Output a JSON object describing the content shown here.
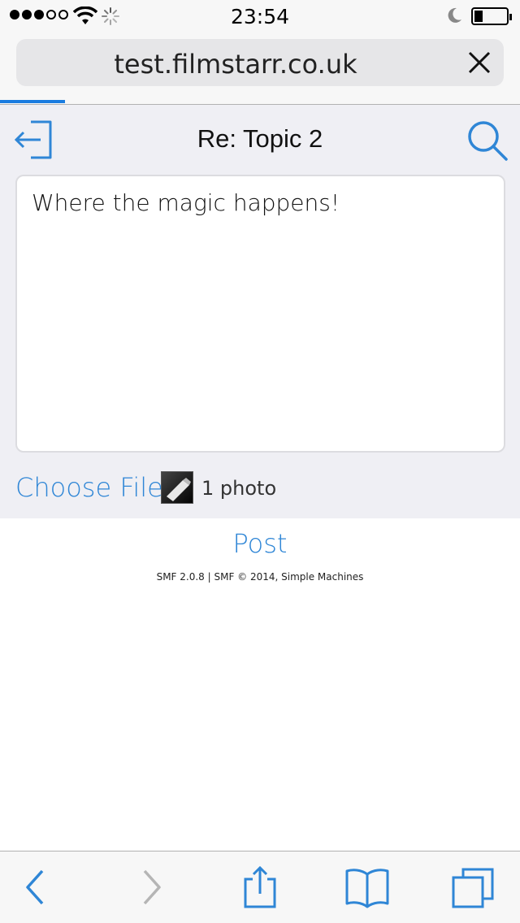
{
  "status_bar": {
    "time": "23:54",
    "signal_bars": 3,
    "signal_total": 5
  },
  "browser": {
    "url": "test.filmstarr.co.uk"
  },
  "header": {
    "title": "Re: Topic 2"
  },
  "composer": {
    "message": "Where the magic happens!",
    "choose_file_label": "Choose File",
    "attachment_count_label": "1 photo"
  },
  "actions": {
    "post_label": "Post"
  },
  "footer": {
    "copyright": "SMF 2.0.8 | SMF © 2014, Simple Machines"
  },
  "colors": {
    "accent": "#2f86d6",
    "background": "#efeff4"
  },
  "icons": [
    "wifi-icon",
    "activity-spinner-icon",
    "moon-icon",
    "battery-icon",
    "close-icon",
    "logout-icon",
    "search-icon",
    "chevron-left-icon",
    "chevron-right-icon",
    "share-icon",
    "bookmarks-icon",
    "tabs-icon"
  ]
}
